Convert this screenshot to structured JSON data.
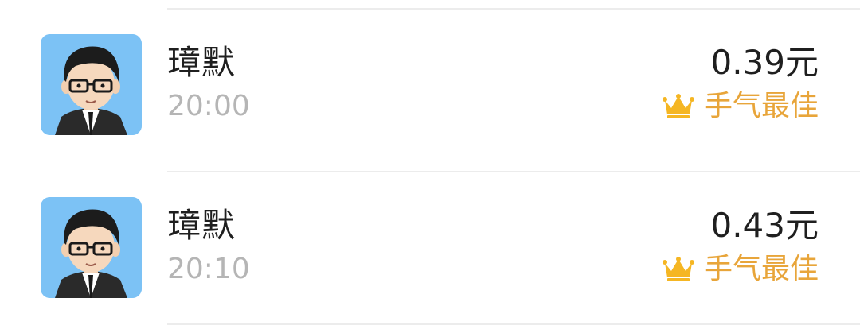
{
  "colors": {
    "name": "#1f1f1f",
    "time": "#b5b5b5",
    "amount": "#1f1f1f",
    "best_label": "#e8a53a",
    "crown": "#f5b623",
    "avatar_bg": "#7cc2f5",
    "divider": "#ececec"
  },
  "records": [
    {
      "avatar_icon": "cartoon-man-glasses-avatar",
      "name": "璋默",
      "time": "20:00",
      "amount": "0.39元",
      "badge_icon": "crown-icon",
      "badge_label": "手气最佳"
    },
    {
      "avatar_icon": "cartoon-man-glasses-avatar",
      "name": "璋默",
      "time": "20:10",
      "amount": "0.43元",
      "badge_icon": "crown-icon",
      "badge_label": "手气最佳"
    }
  ]
}
